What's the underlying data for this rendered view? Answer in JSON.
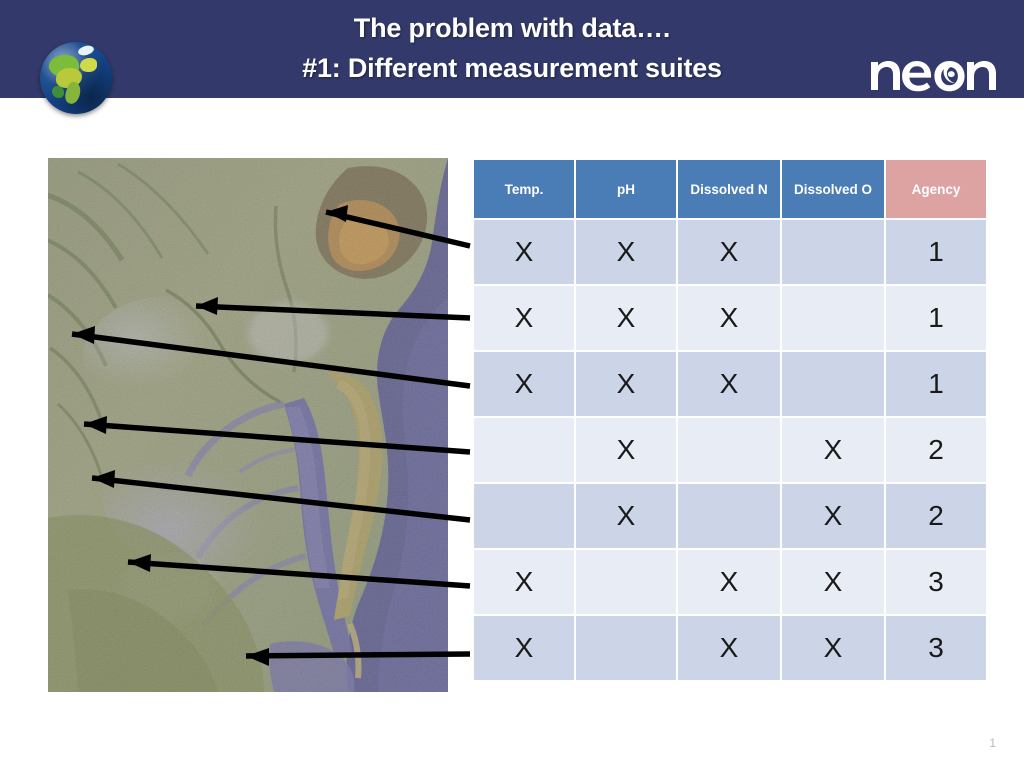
{
  "slide": {
    "title_line1": "The problem with data….",
    "title_line2": "#1: Different measurement suites",
    "banner_color": "#333a6b",
    "page_number": "1"
  },
  "logo": {
    "brand": "neon",
    "alt": "neon-logo"
  },
  "globe": {
    "alt": "globe-icon"
  },
  "map": {
    "alt": "satellite-image-chesapeake-bay",
    "caption": ""
  },
  "table": {
    "columns": [
      {
        "label": "Temp.",
        "key": "temp",
        "header_color": "#4a7db5"
      },
      {
        "label": "pH",
        "key": "ph",
        "header_color": "#4a7db5"
      },
      {
        "label": "Dissolved N",
        "key": "dissolved_n",
        "header_color": "#4a7db5"
      },
      {
        "label": "Dissolved O",
        "key": "dissolved_o",
        "header_color": "#4a7db5"
      },
      {
        "label": "Agency",
        "key": "agency",
        "header_color": "#dda3a3"
      }
    ],
    "mark": "X",
    "rows": [
      {
        "temp": "X",
        "ph": "X",
        "dissolved_n": "X",
        "dissolved_o": "",
        "agency": "1"
      },
      {
        "temp": "X",
        "ph": "X",
        "dissolved_n": "X",
        "dissolved_o": "",
        "agency": "1"
      },
      {
        "temp": "X",
        "ph": "X",
        "dissolved_n": "X",
        "dissolved_o": "",
        "agency": "1"
      },
      {
        "temp": "",
        "ph": "X",
        "dissolved_n": "",
        "dissolved_o": "X",
        "agency": "2"
      },
      {
        "temp": "",
        "ph": "X",
        "dissolved_n": "",
        "dissolved_o": "X",
        "agency": "2"
      },
      {
        "temp": "X",
        "ph": "",
        "dissolved_n": "X",
        "dissolved_o": "X",
        "agency": "3"
      },
      {
        "temp": "X",
        "ph": "",
        "dissolved_n": "X",
        "dissolved_o": "X",
        "agency": "3"
      }
    ]
  },
  "connectors": {
    "count": 7,
    "color": "#000000",
    "description": "arrows-from-table-rows-to-map-sites"
  }
}
